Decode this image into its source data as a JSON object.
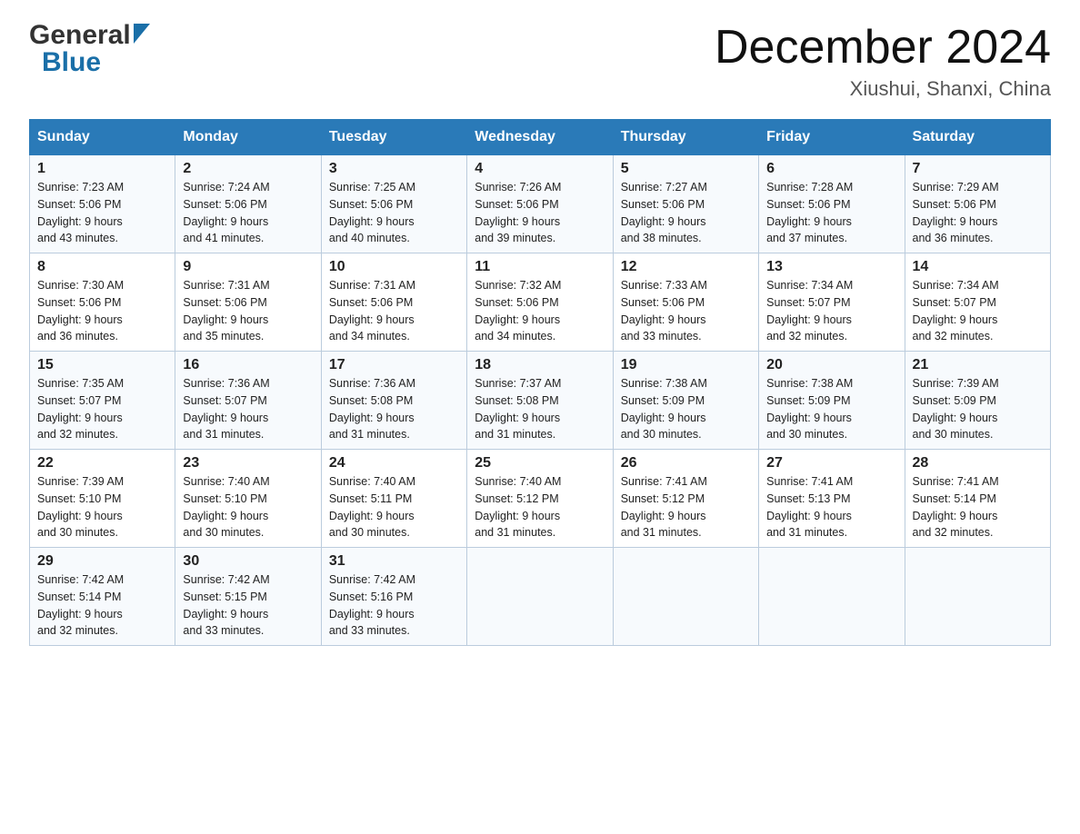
{
  "logo": {
    "general": "General",
    "blue": "Blue"
  },
  "header": {
    "title": "December 2024",
    "location": "Xiushui, Shanxi, China"
  },
  "days_of_week": [
    "Sunday",
    "Monday",
    "Tuesday",
    "Wednesday",
    "Thursday",
    "Friday",
    "Saturday"
  ],
  "weeks": [
    [
      {
        "day": "1",
        "sunrise": "7:23 AM",
        "sunset": "5:06 PM",
        "daylight": "9 hours and 43 minutes."
      },
      {
        "day": "2",
        "sunrise": "7:24 AM",
        "sunset": "5:06 PM",
        "daylight": "9 hours and 41 minutes."
      },
      {
        "day": "3",
        "sunrise": "7:25 AM",
        "sunset": "5:06 PM",
        "daylight": "9 hours and 40 minutes."
      },
      {
        "day": "4",
        "sunrise": "7:26 AM",
        "sunset": "5:06 PM",
        "daylight": "9 hours and 39 minutes."
      },
      {
        "day": "5",
        "sunrise": "7:27 AM",
        "sunset": "5:06 PM",
        "daylight": "9 hours and 38 minutes."
      },
      {
        "day": "6",
        "sunrise": "7:28 AM",
        "sunset": "5:06 PM",
        "daylight": "9 hours and 37 minutes."
      },
      {
        "day": "7",
        "sunrise": "7:29 AM",
        "sunset": "5:06 PM",
        "daylight": "9 hours and 36 minutes."
      }
    ],
    [
      {
        "day": "8",
        "sunrise": "7:30 AM",
        "sunset": "5:06 PM",
        "daylight": "9 hours and 36 minutes."
      },
      {
        "day": "9",
        "sunrise": "7:31 AM",
        "sunset": "5:06 PM",
        "daylight": "9 hours and 35 minutes."
      },
      {
        "day": "10",
        "sunrise": "7:31 AM",
        "sunset": "5:06 PM",
        "daylight": "9 hours and 34 minutes."
      },
      {
        "day": "11",
        "sunrise": "7:32 AM",
        "sunset": "5:06 PM",
        "daylight": "9 hours and 34 minutes."
      },
      {
        "day": "12",
        "sunrise": "7:33 AM",
        "sunset": "5:06 PM",
        "daylight": "9 hours and 33 minutes."
      },
      {
        "day": "13",
        "sunrise": "7:34 AM",
        "sunset": "5:07 PM",
        "daylight": "9 hours and 32 minutes."
      },
      {
        "day": "14",
        "sunrise": "7:34 AM",
        "sunset": "5:07 PM",
        "daylight": "9 hours and 32 minutes."
      }
    ],
    [
      {
        "day": "15",
        "sunrise": "7:35 AM",
        "sunset": "5:07 PM",
        "daylight": "9 hours and 32 minutes."
      },
      {
        "day": "16",
        "sunrise": "7:36 AM",
        "sunset": "5:07 PM",
        "daylight": "9 hours and 31 minutes."
      },
      {
        "day": "17",
        "sunrise": "7:36 AM",
        "sunset": "5:08 PM",
        "daylight": "9 hours and 31 minutes."
      },
      {
        "day": "18",
        "sunrise": "7:37 AM",
        "sunset": "5:08 PM",
        "daylight": "9 hours and 31 minutes."
      },
      {
        "day": "19",
        "sunrise": "7:38 AM",
        "sunset": "5:09 PM",
        "daylight": "9 hours and 30 minutes."
      },
      {
        "day": "20",
        "sunrise": "7:38 AM",
        "sunset": "5:09 PM",
        "daylight": "9 hours and 30 minutes."
      },
      {
        "day": "21",
        "sunrise": "7:39 AM",
        "sunset": "5:09 PM",
        "daylight": "9 hours and 30 minutes."
      }
    ],
    [
      {
        "day": "22",
        "sunrise": "7:39 AM",
        "sunset": "5:10 PM",
        "daylight": "9 hours and 30 minutes."
      },
      {
        "day": "23",
        "sunrise": "7:40 AM",
        "sunset": "5:10 PM",
        "daylight": "9 hours and 30 minutes."
      },
      {
        "day": "24",
        "sunrise": "7:40 AM",
        "sunset": "5:11 PM",
        "daylight": "9 hours and 30 minutes."
      },
      {
        "day": "25",
        "sunrise": "7:40 AM",
        "sunset": "5:12 PM",
        "daylight": "9 hours and 31 minutes."
      },
      {
        "day": "26",
        "sunrise": "7:41 AM",
        "sunset": "5:12 PM",
        "daylight": "9 hours and 31 minutes."
      },
      {
        "day": "27",
        "sunrise": "7:41 AM",
        "sunset": "5:13 PM",
        "daylight": "9 hours and 31 minutes."
      },
      {
        "day": "28",
        "sunrise": "7:41 AM",
        "sunset": "5:14 PM",
        "daylight": "9 hours and 32 minutes."
      }
    ],
    [
      {
        "day": "29",
        "sunrise": "7:42 AM",
        "sunset": "5:14 PM",
        "daylight": "9 hours and 32 minutes."
      },
      {
        "day": "30",
        "sunrise": "7:42 AM",
        "sunset": "5:15 PM",
        "daylight": "9 hours and 33 minutes."
      },
      {
        "day": "31",
        "sunrise": "7:42 AM",
        "sunset": "5:16 PM",
        "daylight": "9 hours and 33 minutes."
      },
      null,
      null,
      null,
      null
    ]
  ],
  "labels": {
    "sunrise": "Sunrise: ",
    "sunset": "Sunset: ",
    "daylight": "Daylight: "
  }
}
